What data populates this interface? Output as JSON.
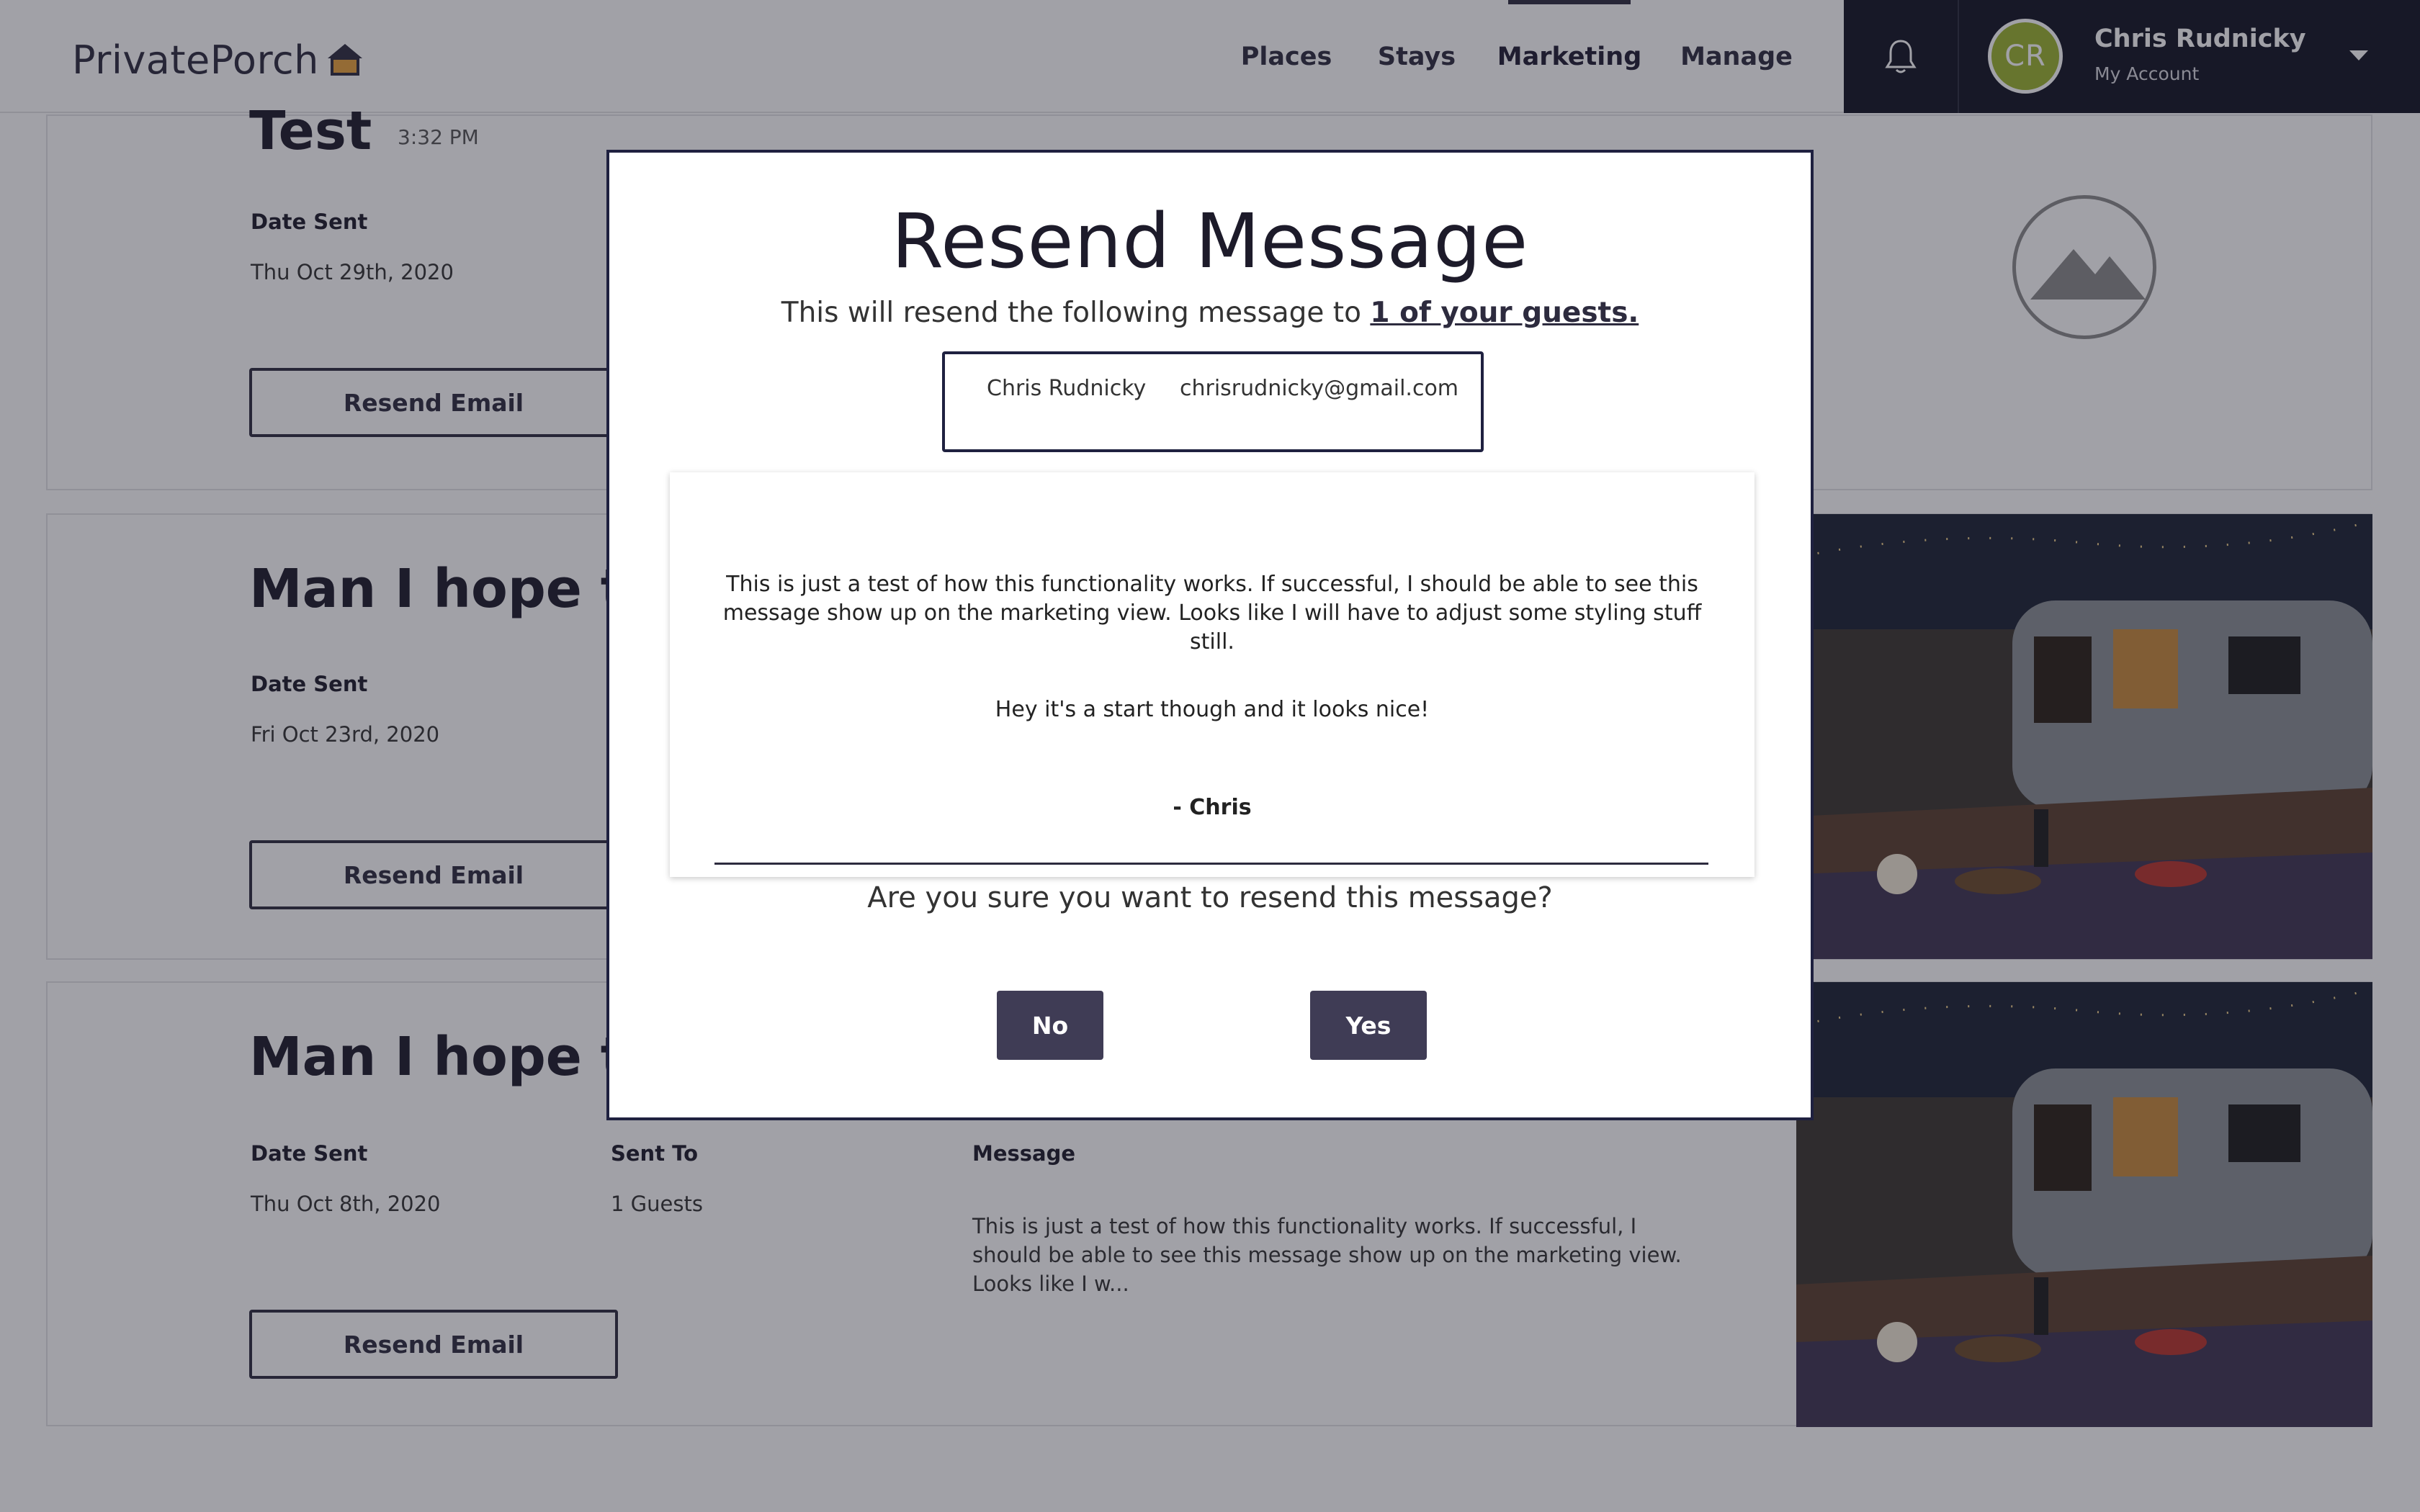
{
  "header": {
    "logo_text_light": "Private",
    "logo_text_bold": "Porch",
    "nav": [
      {
        "label": "Places",
        "active": false
      },
      {
        "label": "Stays",
        "active": false
      },
      {
        "label": "Marketing",
        "active": true
      },
      {
        "label": "Manage",
        "active": false
      }
    ],
    "account": {
      "initials": "CR",
      "name": "Chris Rudnicky",
      "subtitle": "My Account"
    },
    "icons": {
      "bell": "bell-icon",
      "caret": "chevron-down-icon"
    }
  },
  "cards": [
    {
      "title": "Test",
      "time": "3:32 PM",
      "date_label": "Date Sent",
      "date_value": "Thu Oct 29th, 2020",
      "button_label": "Resend Email",
      "image": "placeholder-mountain-icon"
    },
    {
      "title": "Man I hope this",
      "date_label": "Date Sent",
      "date_value": "Fri Oct 23rd, 2020",
      "button_label": "Resend Email",
      "image": "airstream-photo"
    },
    {
      "title": "Man I hope this",
      "date_label": "Date Sent",
      "date_value": "Thu Oct 8th, 2020",
      "sent_to_label": "Sent To",
      "sent_to_value": "1 Guests",
      "message_label": "Message",
      "message_preview": "This is just a test of how this functionality works. If successful, I should be able to see this message show up on the marketing view. Looks like I w...",
      "button_label": "Resend Email",
      "image": "airstream-photo"
    }
  ],
  "modal": {
    "title": "Resend Message",
    "subtitle_prefix": "This will resend the following message to ",
    "subtitle_link": "1 of your guests.",
    "recipient": {
      "name": "Chris Rudnicky",
      "email": "chrisrudnicky@gmail.com"
    },
    "message": {
      "paragraph1": "This is just a test of how this functionality works. If successful, I should be able to see this message show up on the marketing view. Looks like I will have to adjust some styling stuff still.",
      "paragraph2": "Hey it's a start though and it looks nice!",
      "signature": "- Chris"
    },
    "confirm_question": "Are you sure you want to resend this message?",
    "no_label": "No",
    "yes_label": "Yes"
  },
  "colors": {
    "brand_dark": "#2d2b3e",
    "account_panel": "#121424",
    "avatar": "#9bb32f",
    "modal_button": "#3f3c55"
  }
}
